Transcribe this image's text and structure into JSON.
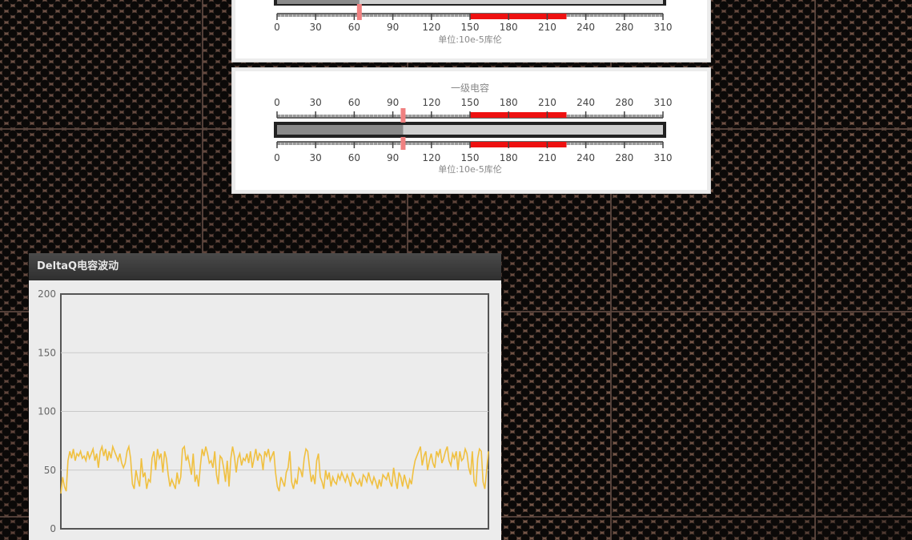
{
  "gauges": [
    {
      "title": "",
      "unit": "单位:10e-5库伦",
      "value": 64,
      "ticks": [
        "0",
        "30",
        "60",
        "90",
        "120",
        "150",
        "180",
        "210",
        "240",
        "280",
        "310"
      ],
      "alarm_range": [
        150,
        225
      ],
      "max": 310
    },
    {
      "title": "一级电容",
      "unit": "单位:10e-5库伦",
      "value": 98,
      "ticks": [
        "0",
        "30",
        "60",
        "90",
        "120",
        "150",
        "180",
        "210",
        "240",
        "280",
        "310"
      ],
      "alarm_range": [
        150,
        225
      ],
      "max": 310
    }
  ],
  "colors": {
    "alarm": "#ee1111",
    "pointer": "#f08080",
    "series": "#f0c040"
  },
  "chart": {
    "header": "DeltaQ电容波动"
  },
  "chart_data": {
    "type": "line",
    "title": "DeltaQ电容波动",
    "ylim": [
      0,
      200
    ],
    "y_ticks": [
      0,
      50,
      100,
      150,
      200
    ],
    "grid": true,
    "series": [
      {
        "values": [
          30,
          44,
          36,
          32,
          58,
          66,
          60,
          68,
          58,
          64,
          62,
          66,
          60,
          62,
          58,
          66,
          60,
          64,
          68,
          58,
          64,
          52,
          66,
          70,
          62,
          68,
          58,
          66,
          60,
          70,
          66,
          62,
          58,
          64,
          56,
          52,
          56,
          66,
          70,
          60,
          38,
          34,
          50,
          42,
          36,
          60,
          44,
          48,
          34,
          42,
          40,
          60,
          66,
          50,
          68,
          60,
          64,
          48,
          66,
          60,
          46,
          36,
          42,
          38,
          34,
          48,
          38,
          44,
          68,
          70,
          58,
          62,
          54,
          46,
          64,
          40,
          46,
          36,
          54,
          68,
          62,
          70,
          64,
          56,
          58,
          52,
          66,
          46,
          38,
          62,
          60,
          52,
          40,
          58,
          36,
          60,
          70,
          62,
          48,
          60,
          64,
          54,
          60,
          58,
          64,
          56,
          66,
          52,
          60,
          68,
          58,
          64,
          62,
          50,
          66,
          62,
          68,
          58,
          62,
          66,
          48,
          36,
          32,
          44,
          40,
          36,
          48,
          52,
          66,
          40,
          34,
          42,
          38,
          52,
          50,
          44,
          60,
          68,
          66,
          52,
          40,
          46,
          38,
          58,
          64,
          44,
          40,
          34,
          50,
          42,
          48,
          36,
          44,
          40,
          38,
          46,
          42,
          48,
          44,
          40,
          46,
          42,
          36,
          48,
          44,
          40,
          38,
          42,
          36,
          46,
          44,
          40,
          48,
          42,
          38,
          44,
          40,
          34,
          42,
          36,
          46,
          44,
          42,
          48,
          40,
          36,
          52,
          42,
          34,
          48,
          44,
          36,
          46,
          40,
          34,
          42,
          38,
          50,
          58,
          62,
          66,
          70,
          54,
          62,
          66,
          50,
          58,
          64,
          56,
          52,
          66,
          62,
          68,
          56,
          60,
          66,
          70,
          58,
          54,
          64,
          60,
          66,
          50,
          66,
          58,
          60,
          68,
          64,
          52,
          46,
          66,
          40,
          36,
          60,
          68,
          66,
          40,
          34,
          50,
          66
        ]
      }
    ]
  }
}
